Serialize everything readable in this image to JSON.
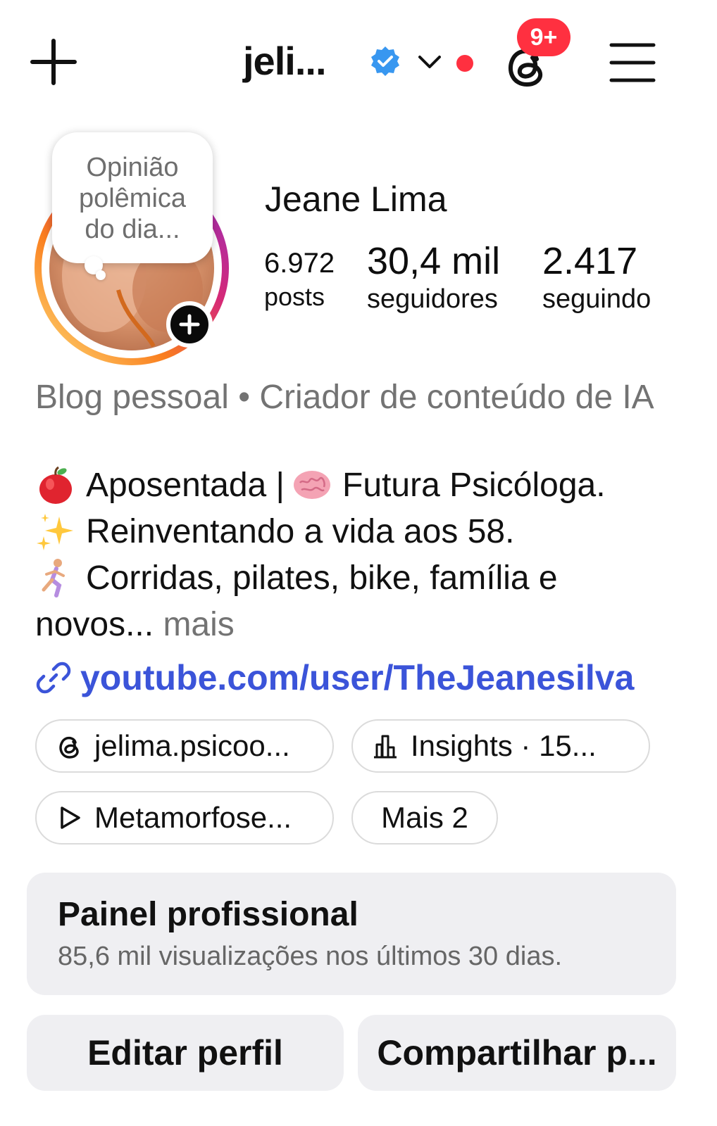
{
  "header": {
    "username": "jeli...",
    "notification_badge": "9+",
    "accent_color": "#3897f0",
    "badge_color": "#ff3040"
  },
  "profile": {
    "note": [
      "Opinião",
      "polêmica",
      "do dia..."
    ],
    "name": "Jeane Lima",
    "stats": {
      "posts_value": "6.972",
      "posts_label": "posts",
      "followers_value": "30,4 mil",
      "followers_label": "seguidores",
      "following_value": "2.417",
      "following_label": "seguindo"
    }
  },
  "bio": {
    "category": "Blog pessoal • Criador de conteúdo de IA",
    "lines": [
      {
        "emoji": "apple-icon",
        "text": "Aposentada | "
      },
      {
        "emoji": "sparkles-icon",
        "text": "Reinventando a vida aos 58."
      },
      {
        "emoji": "runner-icon",
        "text": "Corridas, pilates, bike, família e"
      }
    ],
    "line1_after": "Futura Psicóloga.",
    "last_line": "novos...",
    "more_label": "mais",
    "link": "youtube.com/user/TheJeanesilva",
    "link_color": "#3b54d9"
  },
  "chips": {
    "threads": "jelima.psicoo...",
    "insights": "Insights · 15...",
    "reel": "Metamorfose...",
    "more": "Mais 2"
  },
  "dashboard": {
    "title": "Painel profissional",
    "subtitle": "85,6 mil visualizações nos últimos 30 dias."
  },
  "buttons": {
    "edit": "Editar perfil",
    "share": "Compartilhar p..."
  }
}
